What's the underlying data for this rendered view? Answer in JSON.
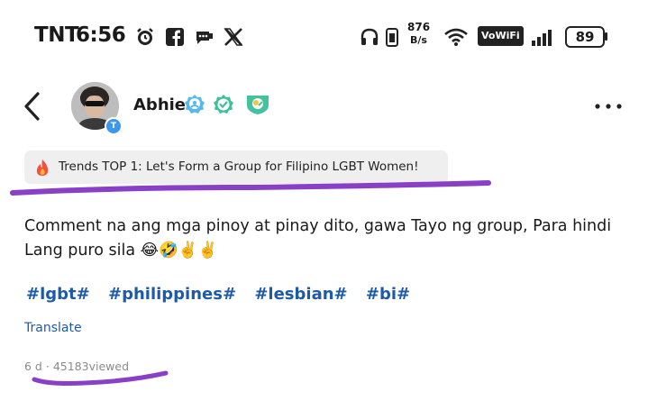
{
  "status_bar": {
    "carrier": "TNT",
    "time": "6:56",
    "network_speed_top": "876",
    "network_speed_bottom": "B/s",
    "wifi_label": "VoWiFi",
    "battery": "89"
  },
  "header": {
    "username": "Abhie",
    "avatar_badge": "T"
  },
  "trend": {
    "label": "Trends TOP 1: Let's Form a Group for Filipino LGBT Women!"
  },
  "post": {
    "text": "Comment na ang mga pinoy at pinay dito, gawa Tayo ng group, Para hindi Lang puro sila 😂🤣✌️✌️",
    "tags": [
      "#lgbt#",
      "#philippines#",
      "#lesbian#",
      "#bi#"
    ],
    "translate": "Translate",
    "age": "6 d",
    "separator": "·",
    "views": "45183viewed"
  },
  "colors": {
    "link_blue": "#1d5aa8",
    "annotation_purple": "#8a3fc7",
    "pill_bg": "#efefef"
  },
  "icons": [
    "alarm-icon",
    "facebook-icon",
    "message-icon",
    "x-logo-icon",
    "headphones-icon",
    "phone-battery-icon",
    "wifi-icon",
    "signal-icon",
    "back-arrow-icon",
    "verified-icon",
    "check-badge-icon",
    "shield-badge-icon",
    "more-icon",
    "fire-icon"
  ]
}
